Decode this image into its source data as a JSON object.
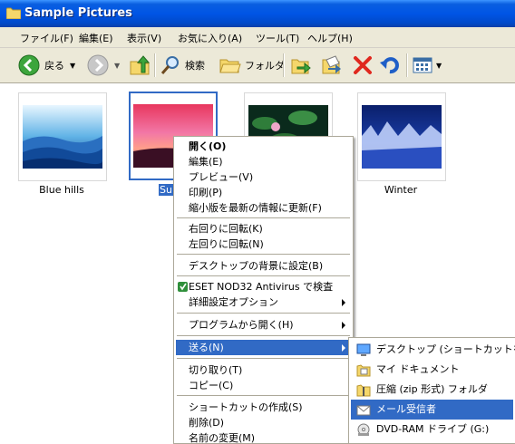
{
  "window": {
    "title": "Sample Pictures"
  },
  "menu": [
    "ファイル(F)",
    "編集(E)",
    "表示(V)",
    "お気に入り(A)",
    "ツール(T)",
    "ヘルプ(H)"
  ],
  "toolbar": {
    "back": "戻る",
    "search": "検索",
    "folders": "フォルダ"
  },
  "thumbnails": [
    {
      "label": "Blue hills",
      "selected": false
    },
    {
      "label": "Sun",
      "selected": true
    },
    {
      "label": "",
      "selected": false
    },
    {
      "label": "Winter",
      "selected": false
    }
  ],
  "context_menu": {
    "items": [
      {
        "label": "開く(O)",
        "bold": true
      },
      {
        "label": "編集(E)"
      },
      {
        "label": "プレビュー(V)"
      },
      {
        "label": "印刷(P)"
      },
      {
        "label": "縮小版を最新の情報に更新(F)"
      },
      {
        "label": "右回りに回転(K)"
      },
      {
        "label": "左回りに回転(N)"
      },
      {
        "label": "デスクトップの背景に設定(B)"
      },
      {
        "label": "ESET NOD32 Antivirus で検査"
      },
      {
        "label": "詳細設定オプション"
      },
      {
        "label": "プログラムから開く(H)"
      },
      {
        "label": "送る(N)"
      },
      {
        "label": "切り取り(T)"
      },
      {
        "label": "コピー(C)"
      },
      {
        "label": "ショートカットの作成(S)"
      },
      {
        "label": "削除(D)"
      },
      {
        "label": "名前の変更(M)"
      }
    ]
  },
  "send_to_menu": {
    "items": [
      {
        "label": "デスクトップ (ショートカットを作成)"
      },
      {
        "label": "マイ ドキュメント"
      },
      {
        "label": "圧縮 (zip 形式) フォルダ"
      },
      {
        "label": "メール受信者"
      },
      {
        "label": "DVD-RAM ドライブ (G:)"
      }
    ]
  },
  "colors": {
    "selection": "#316ac5",
    "titlebar": "#0055e5",
    "chrome": "#ece9d8"
  }
}
